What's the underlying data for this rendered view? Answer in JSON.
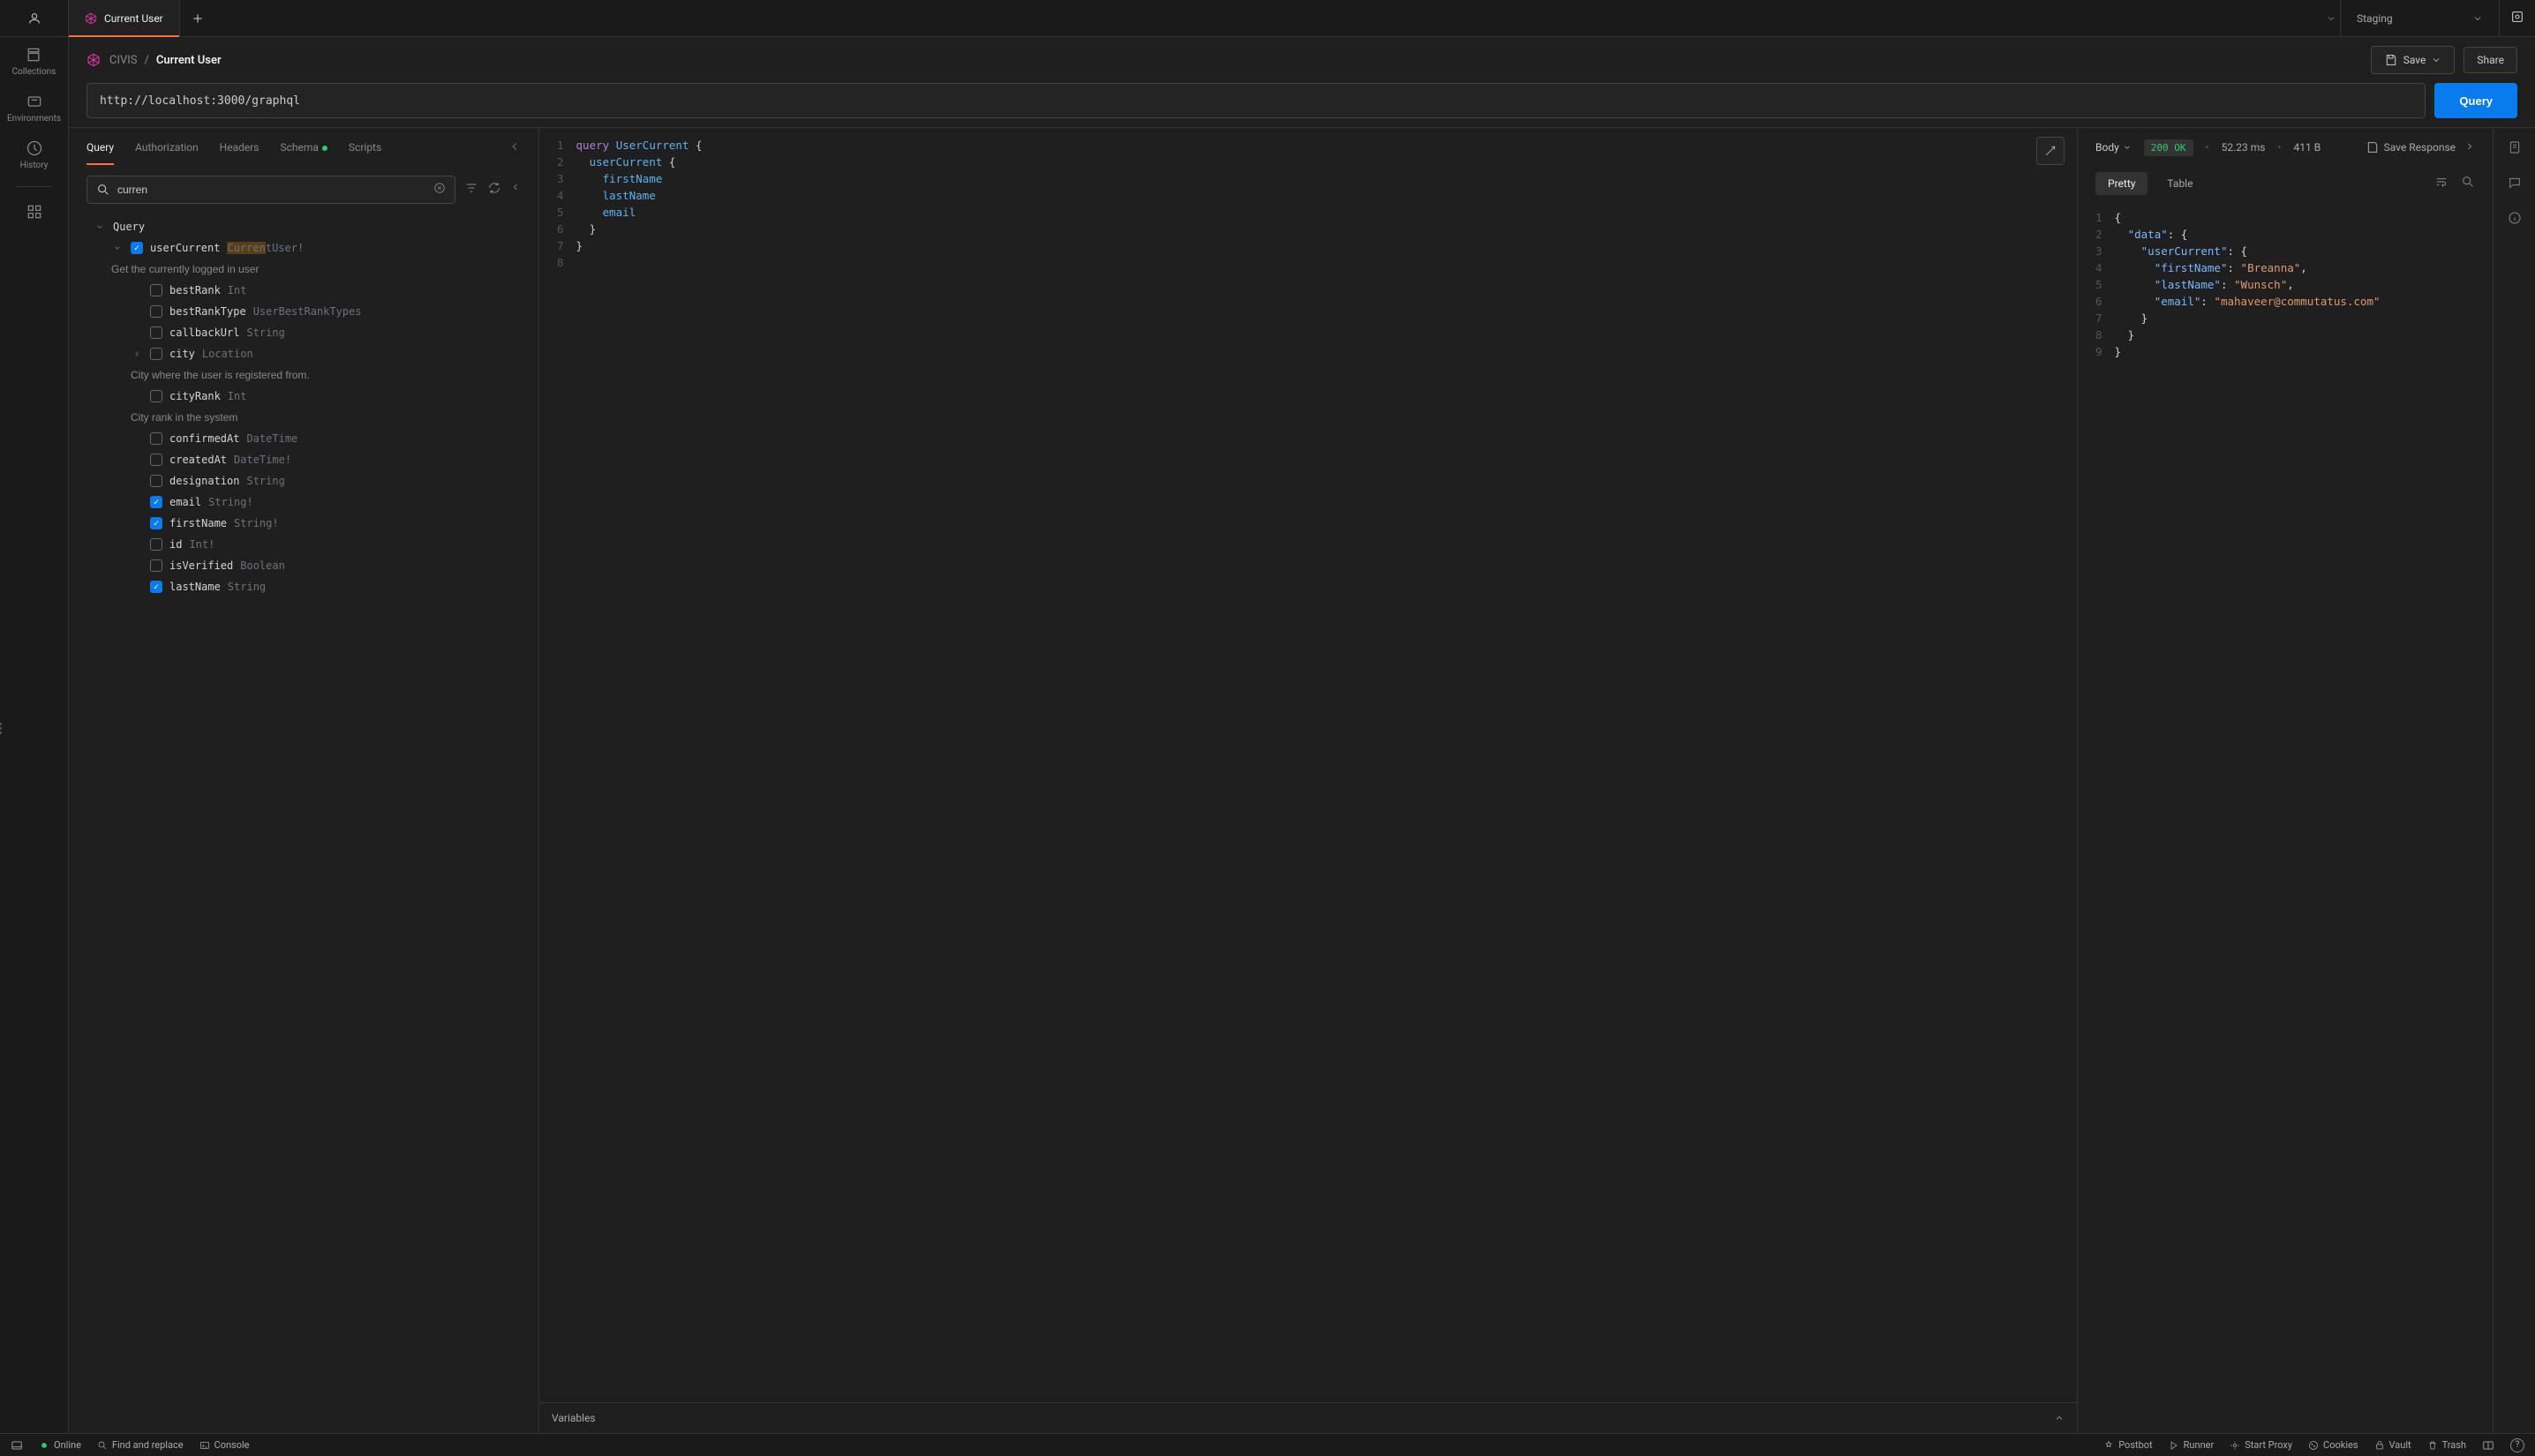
{
  "tab": {
    "label": "Current User"
  },
  "environment": {
    "label": "Staging"
  },
  "breadcrumb": {
    "workspace": "CIVIS",
    "sep": "/",
    "current": "Current User"
  },
  "actions": {
    "save": "Save",
    "share": "Share"
  },
  "url": {
    "value": "http://localhost:3000/graphql"
  },
  "queryButton": "Query",
  "sidebar": {
    "collections": "Collections",
    "environments": "Environments",
    "history": "History"
  },
  "explorerTabs": {
    "query": "Query",
    "authorization": "Authorization",
    "headers": "Headers",
    "schema": "Schema",
    "scripts": "Scripts"
  },
  "search": {
    "value": "curren"
  },
  "tree": {
    "root": "Query",
    "userCurrent": {
      "name": "userCurrent",
      "matchPrefix": "Curren",
      "matchRest": "tUser!",
      "doc": "Get the currently logged in user"
    },
    "fields": [
      {
        "name": "bestRank",
        "type": "Int",
        "checked": false
      },
      {
        "name": "bestRankType",
        "type": "UserBestRankTypes",
        "checked": false
      },
      {
        "name": "callbackUrl",
        "type": "String",
        "checked": false
      },
      {
        "name": "city",
        "type": "Location",
        "checked": false,
        "expandable": true,
        "doc": "City where the user is registered from."
      },
      {
        "name": "cityRank",
        "type": "Int",
        "checked": false,
        "doc": "City rank in the system"
      },
      {
        "name": "confirmedAt",
        "type": "DateTime",
        "checked": false
      },
      {
        "name": "createdAt",
        "type": "DateTime!",
        "checked": false
      },
      {
        "name": "designation",
        "type": "String",
        "checked": false
      },
      {
        "name": "email",
        "type": "String!",
        "checked": true
      },
      {
        "name": "firstName",
        "type": "String!",
        "checked": true
      },
      {
        "name": "id",
        "type": "Int!",
        "checked": false
      },
      {
        "name": "isVerified",
        "type": "Boolean",
        "checked": false
      },
      {
        "name": "lastName",
        "type": "String",
        "checked": true
      }
    ]
  },
  "queryCode": {
    "l1a": "query",
    "l1b": " UserCurrent ",
    "l1c": "{",
    "l2a": "  userCurrent ",
    "l2b": "{",
    "l3": "    firstName",
    "l4": "    lastName",
    "l5": "    email",
    "l6": "  }",
    "l7": "}",
    "l8": ""
  },
  "variablesLabel": "Variables",
  "response": {
    "bodyLabel": "Body",
    "status": "200 OK",
    "time": "52.23 ms",
    "size": "411 B",
    "saveResponse": "Save Response",
    "tabs": {
      "pretty": "Pretty",
      "table": "Table"
    },
    "json": {
      "l1": "{",
      "l2a": "  ",
      "l2k": "\"data\"",
      "l2b": ": {",
      "l3a": "    ",
      "l3k": "\"userCurrent\"",
      "l3b": ": {",
      "l4a": "      ",
      "l4k": "\"firstName\"",
      "l4b": ": ",
      "l4v": "\"Breanna\"",
      "l4c": ",",
      "l5a": "      ",
      "l5k": "\"lastName\"",
      "l5b": ": ",
      "l5v": "\"Wunsch\"",
      "l5c": ",",
      "l6a": "      ",
      "l6k": "\"email\"",
      "l6b": ": ",
      "l6v": "\"mahaveer@commutatus.com\"",
      "l7": "    }",
      "l8": "  }",
      "l9": "}"
    }
  },
  "footer": {
    "online": "Online",
    "find": "Find and replace",
    "console": "Console",
    "postbot": "Postbot",
    "runner": "Runner",
    "proxy": "Start Proxy",
    "cookies": "Cookies",
    "vault": "Vault",
    "trash": "Trash"
  }
}
